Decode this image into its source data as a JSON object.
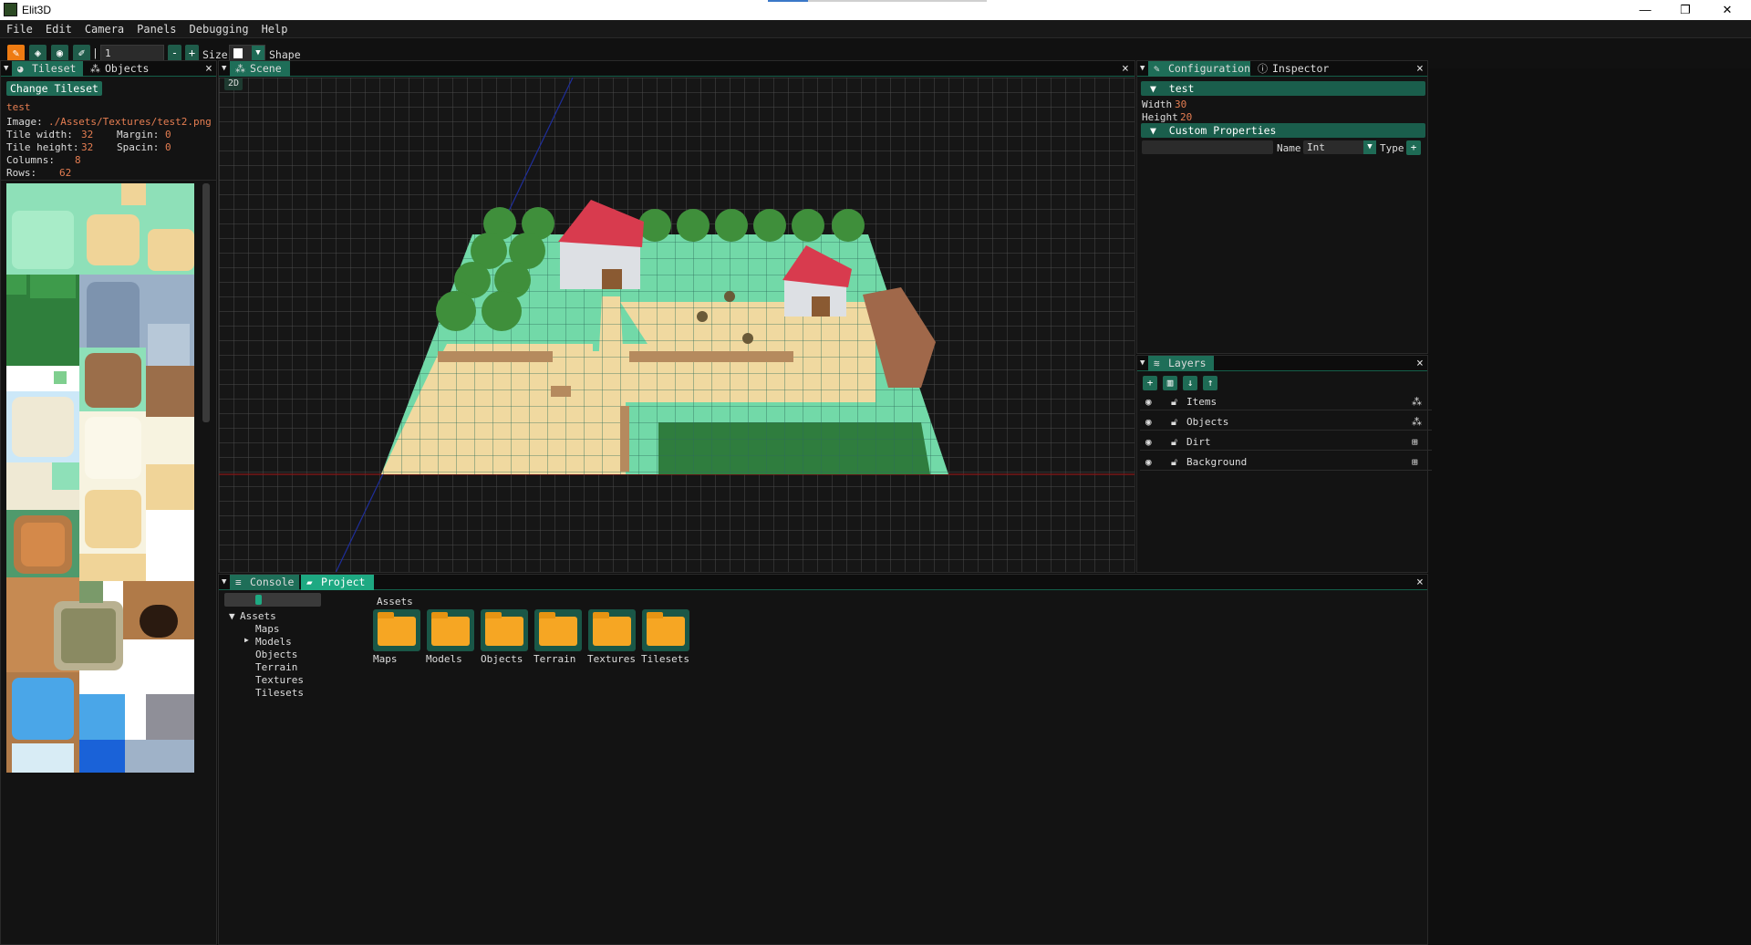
{
  "window": {
    "title": "Elit3D",
    "min": "—",
    "restore": "❐",
    "close": "✕"
  },
  "menu": [
    "File",
    "Edit",
    "Camera",
    "Panels",
    "Debugging",
    "Help"
  ],
  "toolbar": {
    "brush_value": "1",
    "minus": "-",
    "plus": "+",
    "size_label": "Size",
    "shape_label": "Shape",
    "separator": "|"
  },
  "tileset_panel": {
    "tab_tileset": "Tileset",
    "tab_objects": "Objects",
    "change_btn": "Change Tileset",
    "name": "test",
    "image_label": "Image:",
    "image_value": "./Assets/Textures/test2.png",
    "tile_width_label": "Tile width:",
    "tile_width": "32",
    "tile_height_label": "Tile height:",
    "tile_height": "32",
    "margin_label": "Margin:",
    "margin": "0",
    "spacing_label": "Spacin:",
    "spacing": "0",
    "columns_label": "Columns:",
    "columns": "8",
    "rows_label": "Rows:",
    "rows": "62"
  },
  "scene": {
    "tab": "Scene",
    "mode_btn": "2D"
  },
  "config": {
    "tab_config": "Configuration",
    "tab_inspector": "Inspector",
    "section": "test",
    "width_label": "Width",
    "width": "30",
    "height_label": "Height",
    "height": "20",
    "custom_props": "Custom Properties",
    "name_label": "Name",
    "type_value": "Int",
    "type_label": "Type"
  },
  "layers": {
    "tab": "Layers",
    "items": [
      {
        "name": "Items",
        "kind": "objects"
      },
      {
        "name": "Objects",
        "kind": "objects"
      },
      {
        "name": "Dirt",
        "kind": "tiles"
      },
      {
        "name": "Background",
        "kind": "tiles"
      }
    ]
  },
  "bottom": {
    "tab_console": "Console",
    "tab_project": "Project",
    "path": "Assets",
    "tree_root": "Assets",
    "tree": [
      "Maps",
      "Models",
      "Objects",
      "Terrain",
      "Textures",
      "Tilesets"
    ],
    "folders": [
      "Maps",
      "Models",
      "Objects",
      "Terrain",
      "Textures",
      "Tilesets"
    ]
  },
  "colors": {
    "accent": "#1e6e58",
    "active_tool": "#ee7b12",
    "value": "#e67e52",
    "folder": "#f6a623"
  }
}
